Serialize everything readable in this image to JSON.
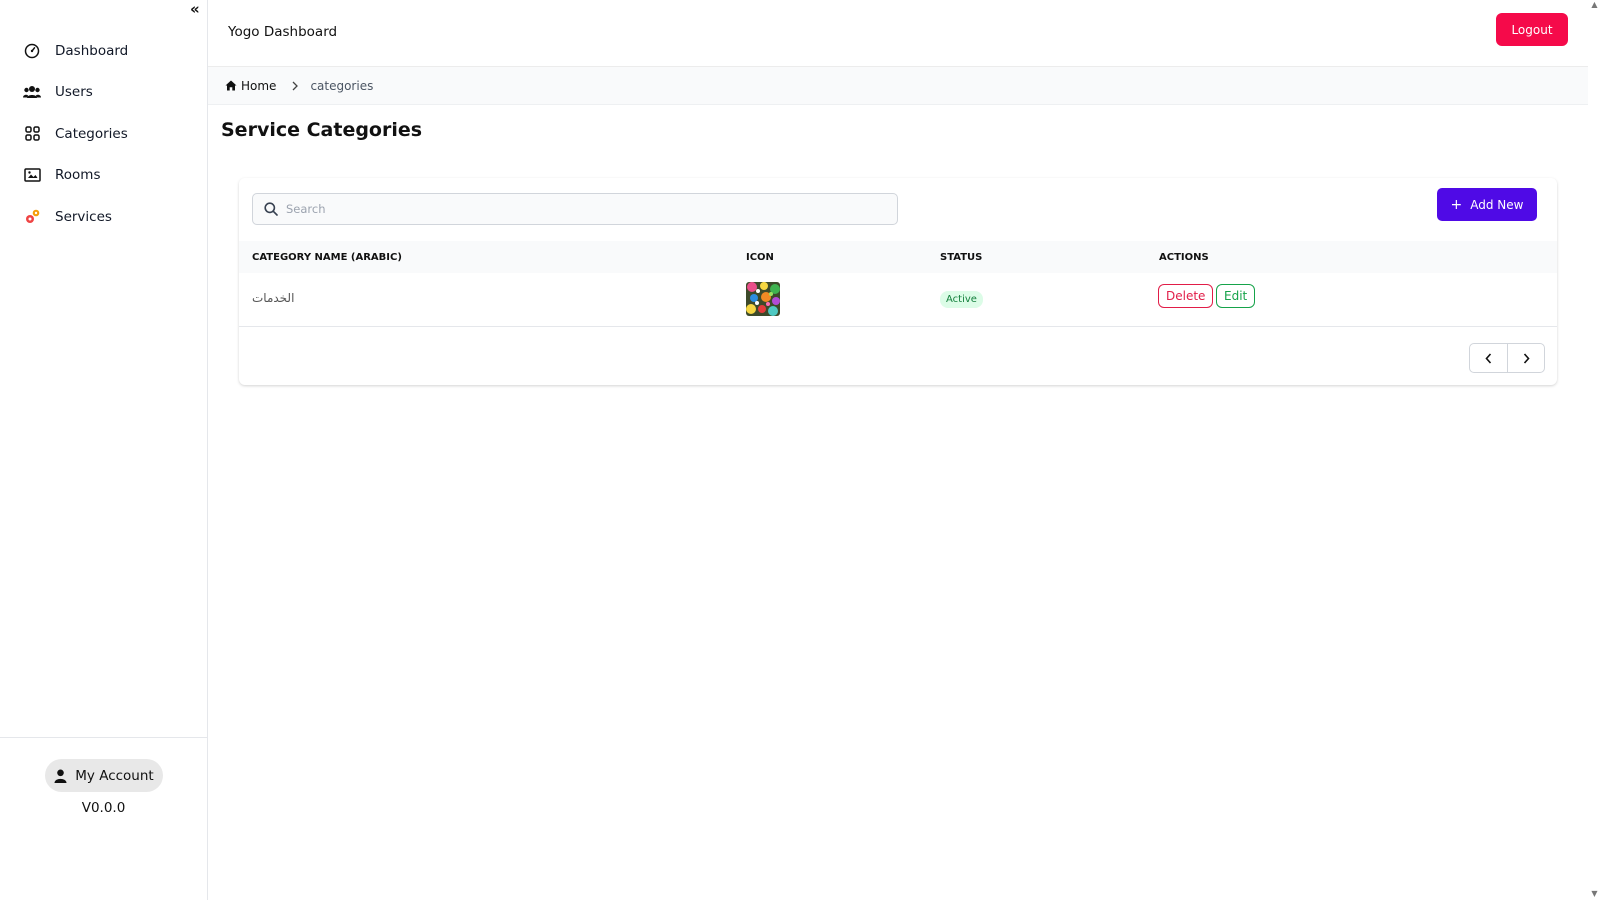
{
  "sidebar": {
    "items": [
      {
        "label": "Dashboard",
        "icon": "dashboard-icon"
      },
      {
        "label": "Users",
        "icon": "users-icon"
      },
      {
        "label": "Categories",
        "icon": "categories-icon"
      },
      {
        "label": "Rooms",
        "icon": "rooms-icon"
      },
      {
        "label": "Services",
        "icon": "services-icon"
      }
    ],
    "account_label": "My Account",
    "version": "V0.0.0"
  },
  "header": {
    "title": "Yogo Dashboard",
    "logout_label": "Logout"
  },
  "breadcrumb": {
    "home": "Home",
    "current": "categories"
  },
  "page": {
    "title": "Service Categories"
  },
  "toolbar": {
    "search_placeholder": "Search",
    "add_label": "Add New"
  },
  "table": {
    "columns": [
      "CATEGORY NAME (ARABIC)",
      "ICON",
      "STATUS",
      "ACTIONS"
    ],
    "rows": [
      {
        "name": "الخدمات",
        "status": "Active",
        "delete_label": "Delete",
        "edit_label": "Edit"
      }
    ]
  },
  "colors": {
    "accent": "#4f0ae6",
    "logout": "#f50a4a",
    "status_active_bg": "#dcfce7",
    "status_active_text": "#15803d",
    "delete": "#e11d48",
    "edit": "#16a34a"
  }
}
